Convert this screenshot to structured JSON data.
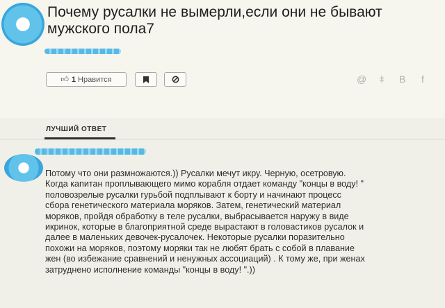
{
  "question": {
    "title_line1": "Почему русалки не вымерли,если они не бывают",
    "title_line2": "мужского пола7"
  },
  "actions": {
    "like_icon": "thumbs-up-icon",
    "like_count": "1",
    "like_label": "Нравится",
    "bookmark_icon": "bookmark-icon",
    "report_icon": "block-icon"
  },
  "share": {
    "at": "@",
    "ok": "ǂ",
    "vk": "В",
    "fb": "f"
  },
  "best_answer": {
    "label": "ЛУЧШИЙ ОТВЕТ"
  },
  "answer": {
    "lines": [
      "Потому что они размножаются.)) Русалки мечут икру. Черную, осетровую.",
      "Когда капитан проплывающего мимо корабля отдает команду \"концы в воду! \"",
      "половозрелые русалки гурьбой подплывают к борту и начинают процесс",
      "сбора генетического материала моряков. Затем, генетический материал",
      "моряков, пройдя обработку в теле русалки, выбрасывается наружу в виде",
      "икринок, которые в благоприятной среде вырастают в головастиков русалок и",
      "далее в маленьких девочек-русалочек. Некоторые русалки поразительно",
      "похожи на моряков, поэтому моряки так не любят брать с собой в плавание",
      "жен (во избежание сравнений и ненужных ассоциаций) . К тому же, при женах",
      "затруднено исполнение команды \"концы в воду! \".))"
    ]
  },
  "colors": {
    "background": "#f1f0e8",
    "avatar": "#4fb6e6",
    "underline": "#2c2c2c"
  }
}
